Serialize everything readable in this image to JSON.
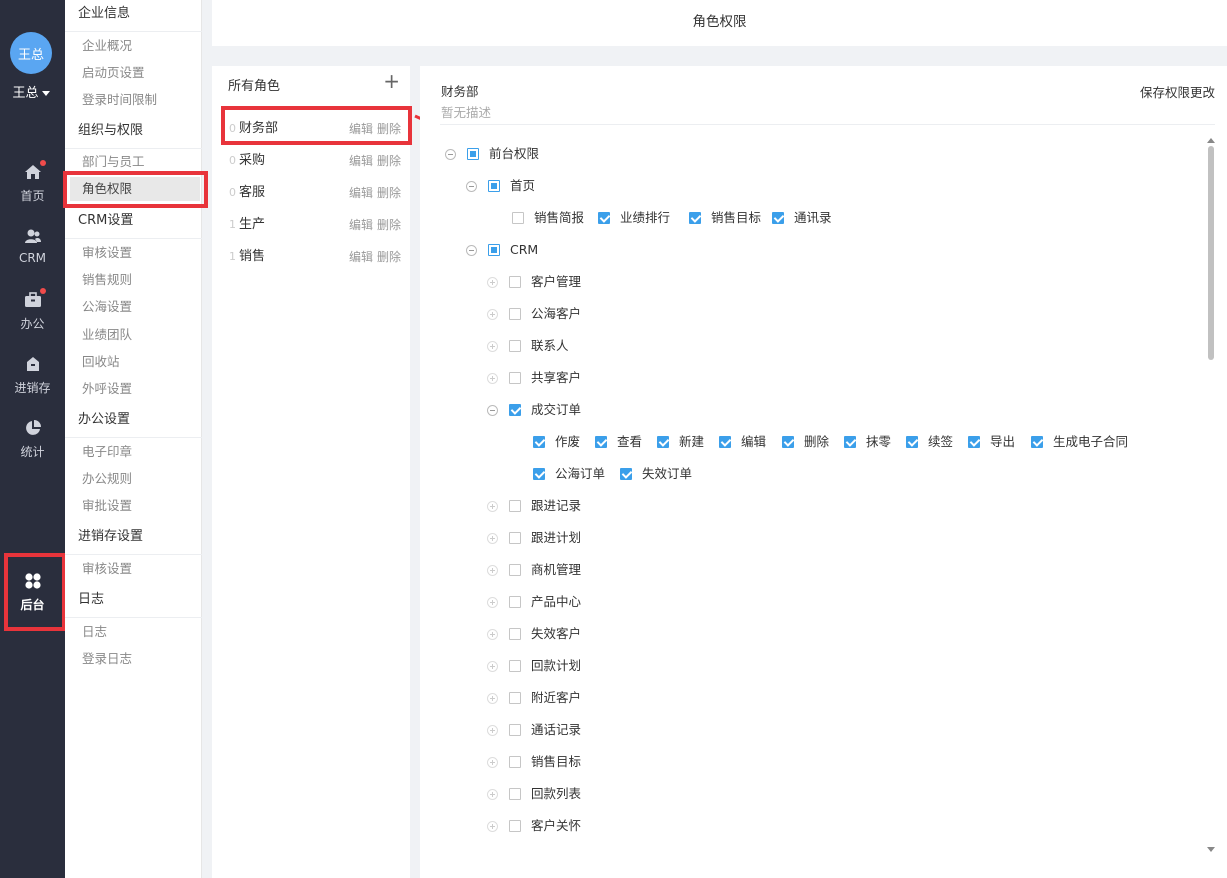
{
  "user": {
    "avatar_text": "王总",
    "name": "王总"
  },
  "nav": {
    "items": [
      {
        "label": "首页",
        "icon": "home-icon",
        "badge": true
      },
      {
        "label": "CRM",
        "icon": "crm-icon",
        "badge": false
      },
      {
        "label": "办公",
        "icon": "briefcase-icon",
        "badge": true
      },
      {
        "label": "进销存",
        "icon": "store-icon",
        "badge": false
      },
      {
        "label": "统计",
        "icon": "pie-chart-icon",
        "badge": false
      },
      {
        "label": "后台",
        "icon": "backstage-icon",
        "badge": false,
        "active": true
      }
    ]
  },
  "submenu": {
    "groups": [
      {
        "title": "企业信息",
        "items": [
          "企业概况",
          "启动页设置",
          "登录时间限制"
        ]
      },
      {
        "title": "组织与权限",
        "items": [
          "部门与员工",
          "角色权限"
        ]
      },
      {
        "title": "CRM设置",
        "items": [
          "审核设置",
          "销售规则",
          "公海设置",
          "业绩团队",
          "回收站",
          "外呼设置"
        ]
      },
      {
        "title": "办公设置",
        "items": [
          "电子印章",
          "办公规则",
          "审批设置"
        ]
      },
      {
        "title": "进销存设置",
        "items": [
          "审核设置"
        ]
      },
      {
        "title": "日志",
        "items": [
          "日志",
          "登录日志"
        ]
      }
    ],
    "active_item": "角色权限"
  },
  "header": {
    "title": "角色权限"
  },
  "roles": {
    "title": "所有角色",
    "add_symbol": "+",
    "edit_label": "编辑",
    "delete_label": "删除",
    "list": [
      {
        "count": "0",
        "name": "财务部"
      },
      {
        "count": "0",
        "name": "采购"
      },
      {
        "count": "0",
        "name": "客服"
      },
      {
        "count": "1",
        "name": "生产"
      },
      {
        "count": "1",
        "name": "销售"
      }
    ]
  },
  "permissions": {
    "role_name": "财务部",
    "description": "暂无描述",
    "save_label": "保存权限更改",
    "tree": {
      "root": "前台权限",
      "home": "首页",
      "home_items": [
        {
          "label": "销售简报",
          "checked": false
        },
        {
          "label": "业绩排行",
          "checked": true
        },
        {
          "label": "销售目标",
          "checked": true
        },
        {
          "label": "通讯录",
          "checked": true
        }
      ],
      "crm": "CRM",
      "crm_before": [
        "客户管理",
        "公海客户",
        "联系人",
        "共享客户"
      ],
      "deal": "成交订单",
      "deal_items": [
        "作废",
        "查看",
        "新建",
        "编辑",
        "删除",
        "抹零",
        "续签",
        "导出",
        "生成电子合同",
        "公海订单",
        "失效订单"
      ],
      "crm_after": [
        "跟进记录",
        "跟进计划",
        "商机管理",
        "产品中心",
        "失效客户",
        "回款计划",
        "附近客户",
        "通话记录",
        "销售目标",
        "回款列表",
        "客户关怀"
      ]
    }
  },
  "colors": {
    "nav_bg": "#2a2e3d",
    "accent": "#3b9fea",
    "highlight": "#e8343b"
  }
}
